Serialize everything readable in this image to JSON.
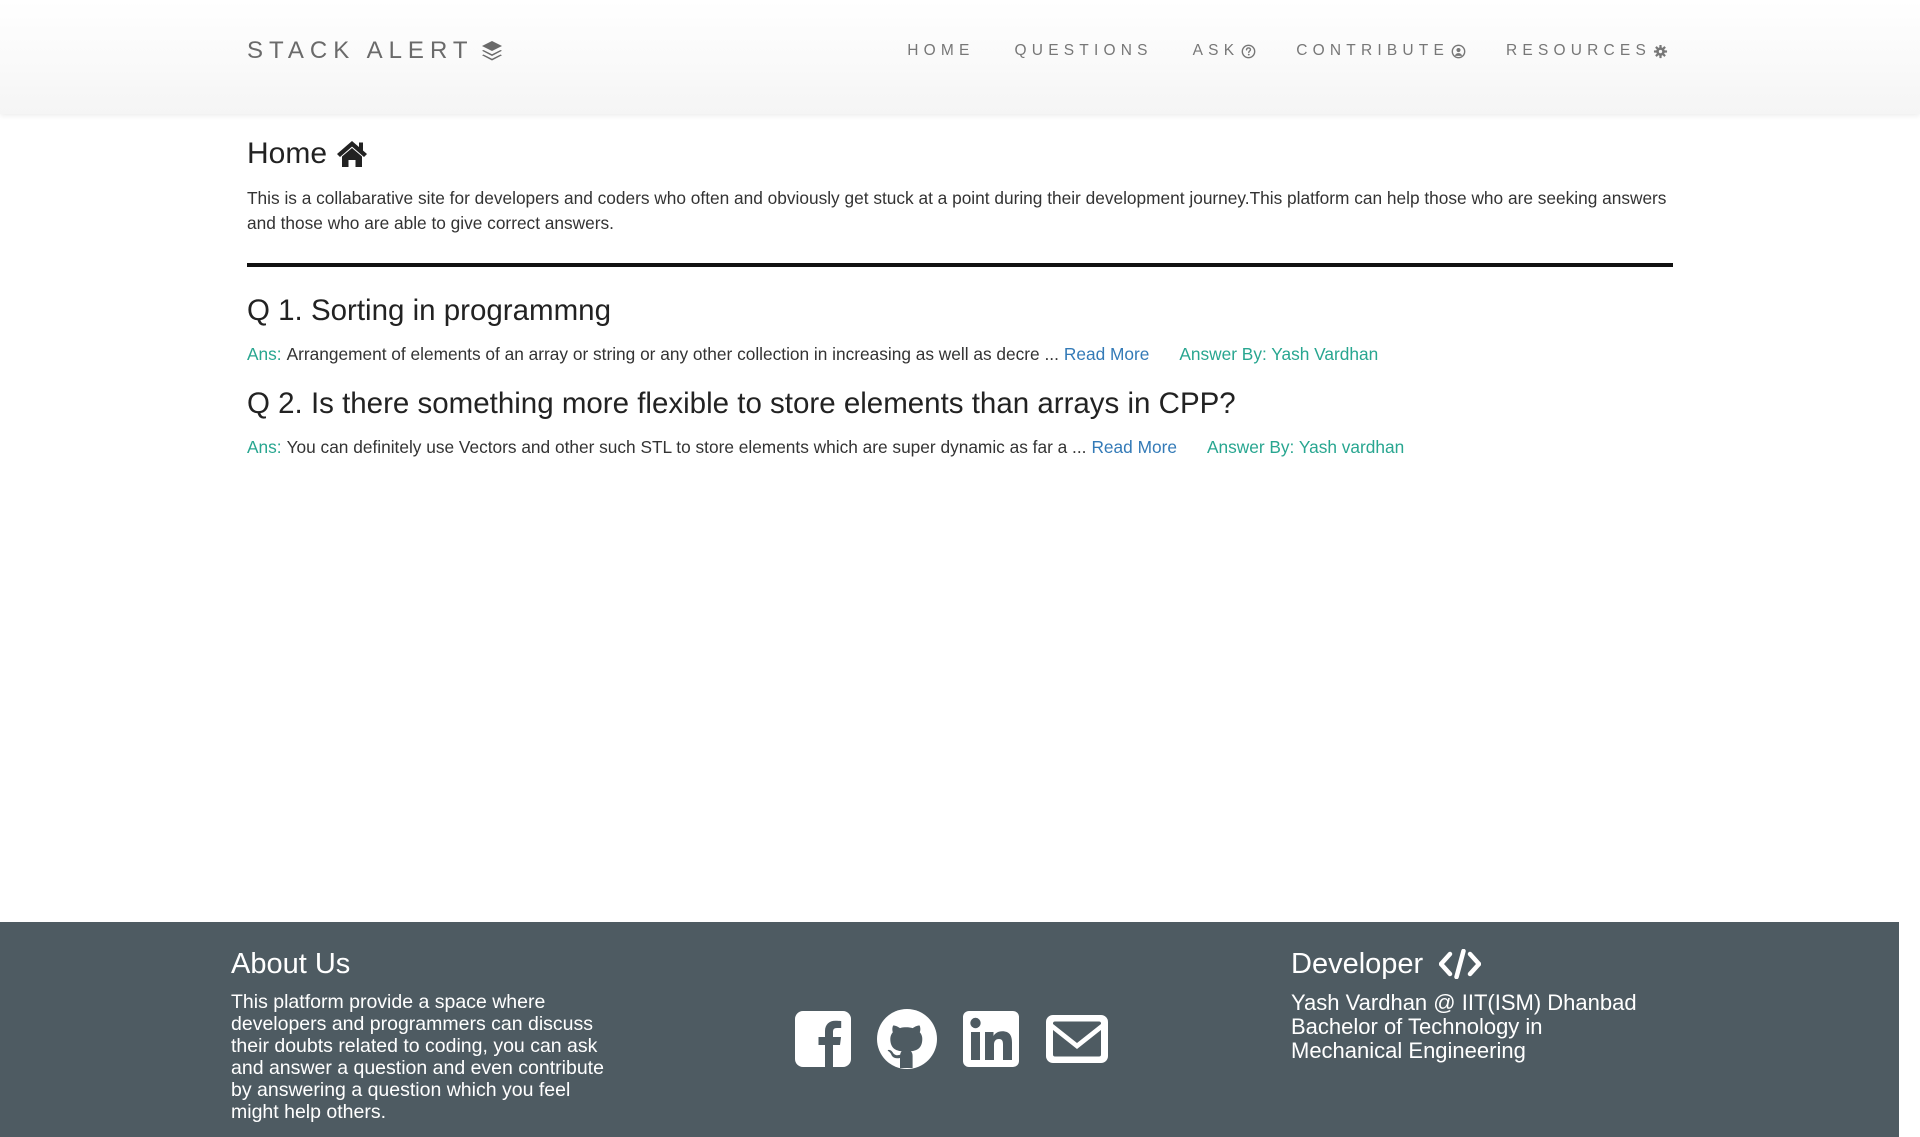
{
  "navbar": {
    "brand": "STACK ALERT",
    "items": [
      {
        "label": "HOME",
        "icon": ""
      },
      {
        "label": "QUESTIONS",
        "icon": ""
      },
      {
        "label": "ASK",
        "icon": "question-circle-icon"
      },
      {
        "label": "CONTRIBUTE",
        "icon": "user-circle-icon"
      },
      {
        "label": "RESOURCES",
        "icon": "gear-icon"
      }
    ]
  },
  "main": {
    "title": "Home",
    "intro": "This is a collabarative site for developers and coders who often and obviously get stuck at a point during their development journey.This platform can help those who are seeking answers and those who are able to give correct answers.",
    "questions": [
      {
        "title": "Q 1. Sorting in programmng",
        "ans_label": "Ans:",
        "answer": "Arrangement of elements of an array or string or any other collection in increasing as well as decre ...",
        "read_more": "Read More",
        "answer_by": "Answer By: Yash Vardhan"
      },
      {
        "title": "Q 2. Is there something more flexible to store elements than arrays in CPP?",
        "ans_label": "Ans:",
        "answer": "You can definitely use Vectors and other such STL to store elements which are super dynamic as far a ...",
        "read_more": "Read More",
        "answer_by": "Answer By: Yash vardhan"
      }
    ]
  },
  "footer": {
    "about_title": "About Us",
    "about_text": "This platform provide a space where developers and programmers can discuss their doubts related to coding, you can ask and answer a question and even contribute by answering a question which you feel might help others.",
    "social": [
      "facebook-icon",
      "github-icon",
      "linkedin-icon",
      "envelope-icon"
    ],
    "developer_title": "Developer",
    "developer_lines": [
      "Yash Vardhan @ IIT(ISM) Dhanbad",
      "Bachelor of Technology in",
      "Mechanical Engineering"
    ]
  },
  "colors": {
    "accent": "#28a690",
    "link": "#337ab7",
    "footer_bg": "#4e5b62",
    "nav_text": "#777777"
  }
}
